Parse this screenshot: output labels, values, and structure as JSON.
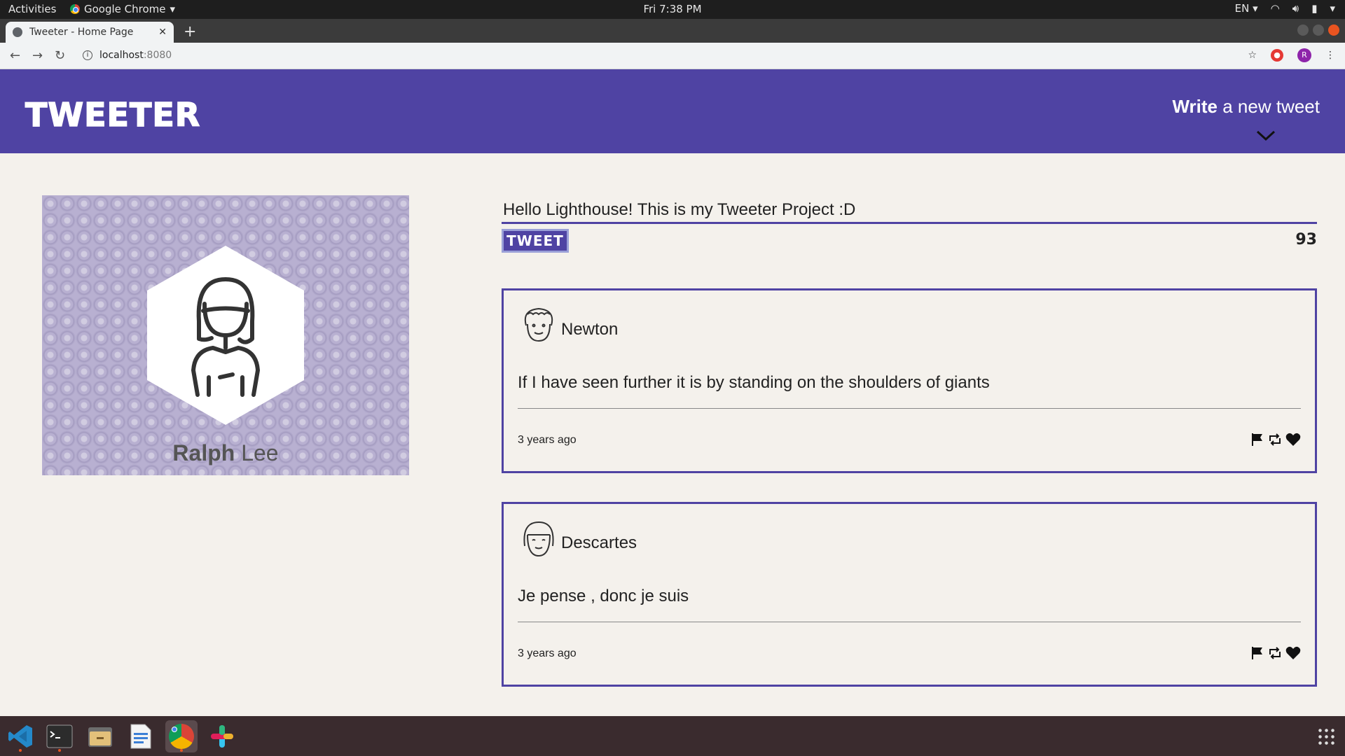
{
  "system_bar": {
    "activities": "Activities",
    "app_name": "Google Chrome",
    "clock": "Fri  7:38 PM",
    "lang": "EN"
  },
  "browser": {
    "tab_title": "Tweeter - Home Page",
    "url_host": "localhost",
    "url_port": ":8080",
    "profile_initial": "R"
  },
  "site": {
    "logo": "TWEETER",
    "compose_bold": "Write",
    "compose_rest": " a new tweet"
  },
  "profile": {
    "first_name": "Ralph",
    "last_name": " Lee"
  },
  "new_tweet": {
    "value": "Hello Lighthouse! This is my Tweeter Project :D",
    "button": "TWEET",
    "counter": "93"
  },
  "tweets": [
    {
      "author": "Newton",
      "content": "If I have seen further it is by standing on the shoulders of giants",
      "time": "3 years ago"
    },
    {
      "author": "Descartes",
      "content": "Je pense , donc je suis",
      "time": "3 years ago"
    }
  ],
  "colors": {
    "brand": "#4f43a3",
    "background": "#f4f1ec"
  }
}
